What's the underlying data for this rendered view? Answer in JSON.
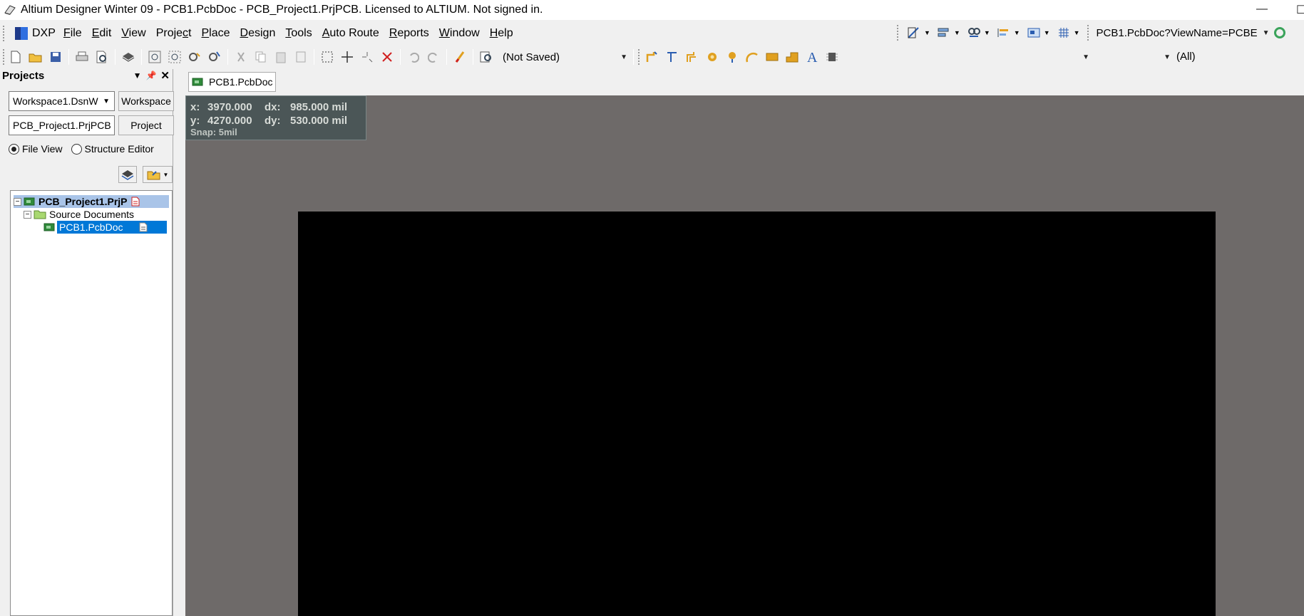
{
  "window": {
    "title": "Altium Designer Winter 09 - PCB1.PcbDoc - PCB_Project1.PrjPCB. Licensed to ALTIUM. Not signed in.",
    "minimize": "—",
    "maximize": "☐"
  },
  "menu": {
    "dxp": "DXP",
    "items": [
      {
        "label": "File",
        "key": "F"
      },
      {
        "label": "Edit",
        "key": "E"
      },
      {
        "label": "View",
        "key": "V"
      },
      {
        "label": "Project",
        "key": "c"
      },
      {
        "label": "Place",
        "key": "P"
      },
      {
        "label": "Design",
        "key": "D"
      },
      {
        "label": "Tools",
        "key": "T"
      },
      {
        "label": "Auto Route",
        "key": "A"
      },
      {
        "label": "Reports",
        "key": "R"
      },
      {
        "label": "Window",
        "key": "W"
      },
      {
        "label": "Help",
        "key": "H"
      }
    ],
    "view_combo": "PCB1.PcbDoc?ViewName=PCBE"
  },
  "toolbar": {
    "variant_combo": "(Not Saved)",
    "filter_combo_1": "",
    "filter_combo_2": "",
    "filter_label": "(All)"
  },
  "projects_panel": {
    "title": "Projects",
    "workspace_field": "Workspace1.DsnW",
    "workspace_button": "Workspace",
    "project_field": "PCB_Project1.PrjPCB",
    "project_button": "Project",
    "file_view_label": "File View",
    "structure_editor_label": "Structure Editor",
    "file_view_selected": true,
    "tree": {
      "project": "PCB_Project1.PrjP",
      "folder": "Source Documents",
      "document": "PCB1.PcbDoc"
    }
  },
  "editor": {
    "tab_label": "PCB1.PcbDoc",
    "coords": {
      "x_label": "x:",
      "x_value": "3970.000",
      "dx_label": "dx:",
      "dx_value": "985.000 mil",
      "y_label": "y:",
      "y_value": "4270.000",
      "dy_label": "dy:",
      "dy_value": "530.000 mil",
      "snap": "Snap: 5mil"
    }
  },
  "colors": {
    "workspace_bg": "#6e6a69",
    "board": "#000000",
    "selection": "#0078d7",
    "project_highlight": "#a9c4e8"
  }
}
